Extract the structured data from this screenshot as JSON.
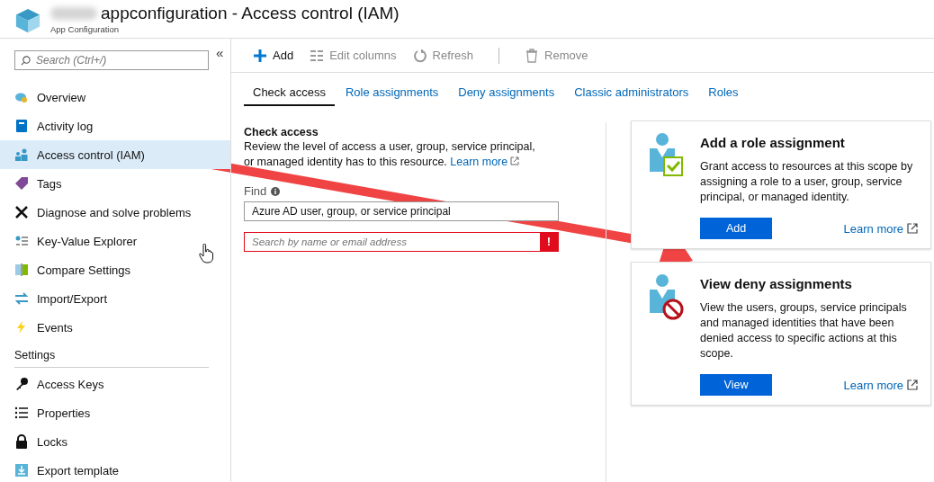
{
  "header": {
    "title": "appconfiguration - Access control (IAM)",
    "subtitle": "App Configuration",
    "redacted": true
  },
  "sidebar": {
    "search_placeholder": "Search (Ctrl+/)",
    "collapse": "«",
    "groups": [
      {
        "items": [
          {
            "label": "Overview",
            "selected": false
          },
          {
            "label": "Activity log",
            "selected": false
          },
          {
            "label": "Access control (IAM)",
            "selected": true
          },
          {
            "label": "Tags",
            "selected": false
          },
          {
            "label": "Diagnose and solve problems",
            "selected": false
          },
          {
            "label": "Key-Value Explorer",
            "selected": false
          },
          {
            "label": "Compare Settings",
            "selected": false
          },
          {
            "label": "Import/Export",
            "selected": false
          },
          {
            "label": "Events",
            "selected": false
          }
        ]
      },
      {
        "heading": "Settings",
        "items": [
          {
            "label": "Access Keys",
            "selected": false
          },
          {
            "label": "Properties",
            "selected": false
          },
          {
            "label": "Locks",
            "selected": false
          },
          {
            "label": "Export template",
            "selected": false
          }
        ]
      }
    ]
  },
  "toolbar": [
    {
      "label": "Add",
      "disabled": false
    },
    {
      "label": "Edit columns",
      "disabled": true
    },
    {
      "label": "Refresh",
      "disabled": true
    },
    {
      "label": "Remove",
      "disabled": true
    }
  ],
  "tabs": [
    {
      "label": "Check access",
      "selected": true
    },
    {
      "label": "Role assignments",
      "selected": false
    },
    {
      "label": "Deny assignments",
      "selected": false
    },
    {
      "label": "Classic administrators",
      "selected": false
    },
    {
      "label": "Roles",
      "selected": false
    }
  ],
  "check_access": {
    "title": "Check access",
    "description": "Review the level of access a user, group, service principal, or managed identity has to this resource.",
    "link": "Learn more",
    "find_label": "Find",
    "find_type": "Azure AD user, group, or service principal",
    "search_placeholder": "Search by name or email address",
    "error": true,
    "error_mark": "!"
  },
  "cards": [
    {
      "kind": "add",
      "title": "Add a role assignment",
      "description": "Grant access to resources at this scope by assigning a role to a user, group, service principal, or managed identity.",
      "button": "Add",
      "link": "Learn more"
    },
    {
      "kind": "deny",
      "title": "View deny assignments",
      "description": "View the users, groups, service principals and managed identities that have been denied access to specific actions at this scope.",
      "button": "View",
      "link": "Learn more"
    }
  ]
}
